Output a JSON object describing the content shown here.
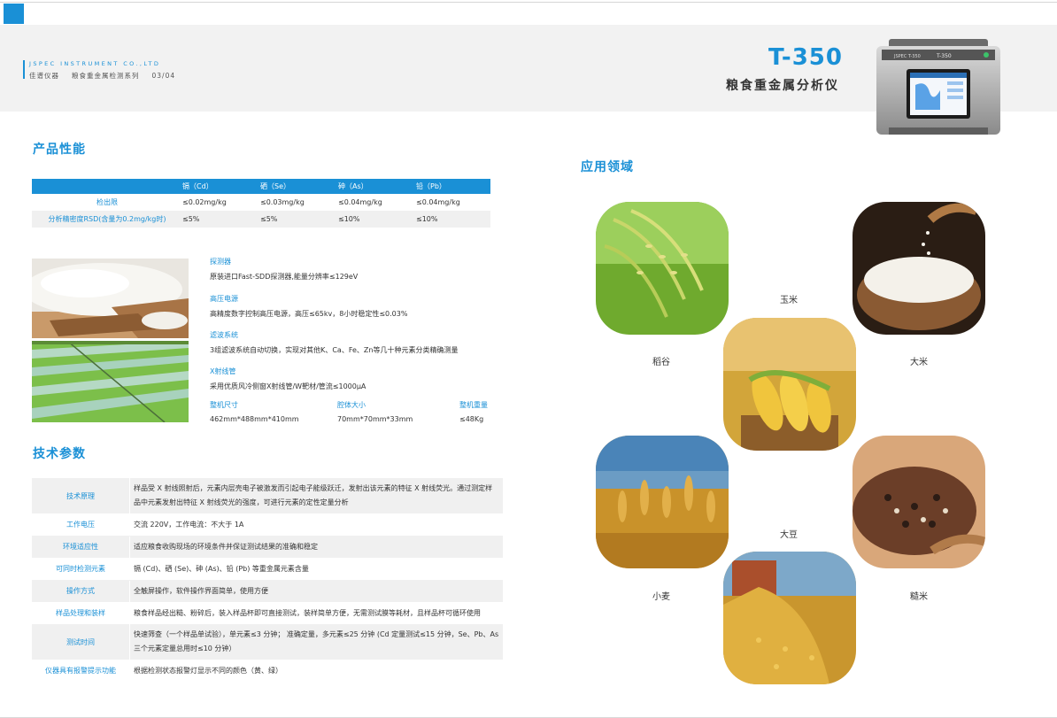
{
  "header": {
    "brand_en": "JSPEC INSTRUMENT CO.,LTD",
    "brand_cn": "佳谱仪器",
    "series": "粮食重金属检测系列",
    "page_no": "03/04",
    "model": "T-350",
    "product_name": "粮食重金属分析仪",
    "device_brand": "JSPEC T-350",
    "device_model": "T-350"
  },
  "performance": {
    "title": "产品性能",
    "headers": [
      "",
      "镉（Cd）",
      "硒（Se）",
      "砷（As）",
      "铅（Pb）"
    ],
    "rows": [
      {
        "label": "检出限",
        "values": [
          "≤0.02mg/kg",
          "≤0.03mg/kg",
          "≤0.04mg/kg",
          "≤0.04mg/kg"
        ]
      },
      {
        "label": "分析精密度RSD(含量为0.2mg/kg时)",
        "values": [
          "≤5%",
          "≤5%",
          "≤10%",
          "≤10%"
        ]
      }
    ]
  },
  "features": [
    {
      "title": "探测器",
      "desc": "原装进口Fast-SDD探测器,能量分辨率≤129eV"
    },
    {
      "title": "高压电源",
      "desc": "高精度数字控制高压电源，高压≤65kv，8小时稳定性≤0.03%"
    },
    {
      "title": "滤波系统",
      "desc": " 3组滤波系统自动切换，实现对其他K、Ca、Fe、Zn等几十种元素分类精确测量"
    },
    {
      "title": "X射线管",
      "desc": "采用优质风冷侧窗X射线管/W靶材/管流≤1000μA"
    }
  ],
  "dimensions": [
    {
      "title": "整机尺寸",
      "value": "462mm*488mm*410mm"
    },
    {
      "title": "腔体大小",
      "value": "70mm*70mm*33mm"
    },
    {
      "title": "整机重量",
      "value": "≤48Kg"
    }
  ],
  "tech_params": {
    "title": "技术参数",
    "rows": [
      {
        "key": "技术原理",
        "value": "样品受 X 射线照射后，元素内层壳电子被激发而引起电子能级跃迁，发射出该元素的特征 X 射线荧光。通过测定样品中元素发射出特征 X 射线荧光的强度，可进行元素的定性定量分析"
      },
      {
        "key": "工作电压",
        "value": "交流 220V，工作电流：不大于 1A"
      },
      {
        "key": "环境适应性",
        "value": "适应粮食收购现场的环境条件并保证测试结果的准确和稳定"
      },
      {
        "key": "可同时检测元素",
        "value": "镉 (Cd)、硒 (Se)、砷 (As)、铅 (Pb) 等重金属元素含量"
      },
      {
        "key": "操作方式",
        "value": "全触屏操作，软件操作界面简单，使用方便"
      },
      {
        "key": "样品处理和装样",
        "value": "粮食样品经出糙、粉碎后，装入样品杯即可直接测试，装样简单方便，无需测试膜等耗材，且样品杯可循环使用"
      },
      {
        "key": "测试时间",
        "value": "快速筛查（一个样品单试验），单元素≤3 分钟； 准确定量，多元素≤25 分钟 (Cd 定量测试≤15 分钟，Se、Pb、As 三个元素定量总用时≤10 分钟）"
      },
      {
        "key": "仪器具有报警提示功能",
        "value": "根据检测状态报警灯显示不同的颜色（黄、绿）"
      }
    ]
  },
  "applications": {
    "title": "应用领域",
    "crops": [
      "稻谷",
      "玉米",
      "大米",
      "小麦",
      "大豆",
      "糙米"
    ]
  },
  "colors": {
    "accent": "#1a90d6",
    "header_band": "#f2f2f2",
    "row_alt": "#f0f0f0"
  }
}
